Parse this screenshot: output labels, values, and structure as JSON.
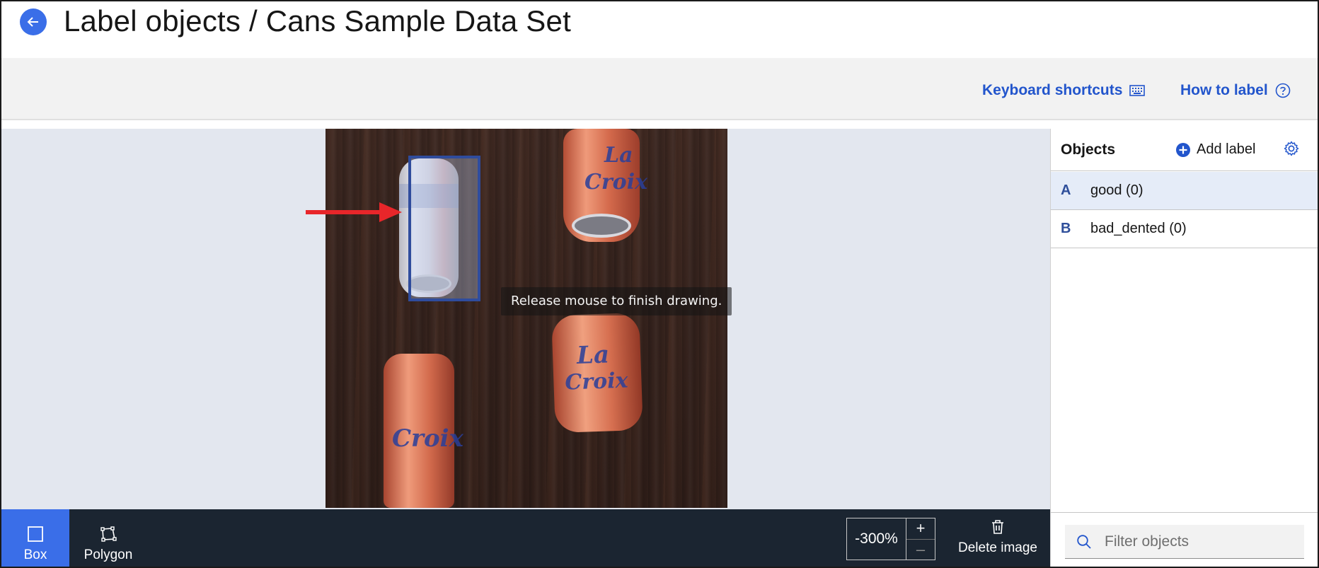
{
  "header": {
    "title": "Label objects / Cans Sample Data Set"
  },
  "toolbar": {
    "keyboard_shortcuts": "Keyboard shortcuts",
    "how_to_label": "How to label"
  },
  "canvas": {
    "hint": "Release mouse to finish drawing."
  },
  "tools": {
    "box_label": "Box",
    "polygon_label": "Polygon",
    "zoom_value": "-300%",
    "zoom_in": "+",
    "zoom_out": "–",
    "delete_label": "Delete image"
  },
  "panel": {
    "title": "Objects",
    "add_label": "Add label",
    "labels": [
      {
        "key": "A",
        "name": "good (0)",
        "selected": true
      },
      {
        "key": "B",
        "name": "bad_dented (0)",
        "selected": false
      }
    ],
    "filter_placeholder": "Filter objects"
  },
  "colors": {
    "accent": "#3a6ee8",
    "link": "#2255cc",
    "bottom_bar": "#1b2531",
    "bbox": "#2f4c9d",
    "arrow": "#e8262a"
  },
  "icons": {
    "back": "arrow-left-icon",
    "keyboard": "keyboard-icon",
    "help": "help-circle-icon",
    "box_tool": "square-icon",
    "polygon_tool": "polygon-icon",
    "delete": "trash-icon",
    "add": "plus-circle-icon",
    "settings": "gear-icon",
    "search": "search-icon"
  }
}
